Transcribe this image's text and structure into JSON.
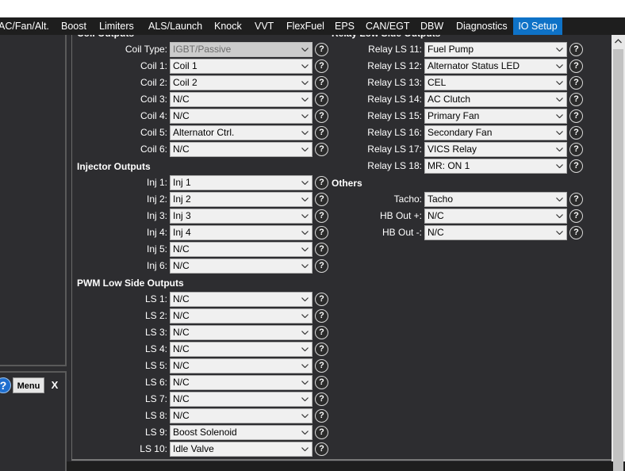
{
  "menu": {
    "items": [
      "AC/Fan/Alt.",
      "Boost",
      "Limiters",
      "ALS/Launch",
      "Knock",
      "VVT",
      "FlexFuel",
      "EPS",
      "CAN/EGT",
      "DBW",
      "Diagnostics",
      "IO Setup"
    ],
    "active": "IO Setup"
  },
  "left_panel": {
    "help_glyph": "?",
    "menu_label": "Menu",
    "close_label": "X"
  },
  "coil": {
    "title": "Coil Outputs",
    "type_label": "Coil Type:",
    "type_value": "IGBT/Passive",
    "rows": [
      {
        "label": "Coil 1:",
        "value": "Coil 1"
      },
      {
        "label": "Coil 2:",
        "value": "Coil 2"
      },
      {
        "label": "Coil 3:",
        "value": "N/C"
      },
      {
        "label": "Coil 4:",
        "value": "N/C"
      },
      {
        "label": "Coil 5:",
        "value": "Alternator Ctrl."
      },
      {
        "label": "Coil 6:",
        "value": "N/C"
      }
    ]
  },
  "injector": {
    "title": "Injector Outputs",
    "rows": [
      {
        "label": "Inj 1:",
        "value": "Inj 1"
      },
      {
        "label": "Inj 2:",
        "value": "Inj 2"
      },
      {
        "label": "Inj 3:",
        "value": "Inj 3"
      },
      {
        "label": "Inj 4:",
        "value": "Inj 4"
      },
      {
        "label": "Inj 5:",
        "value": "N/C"
      },
      {
        "label": "Inj 6:",
        "value": "N/C"
      }
    ]
  },
  "pwm": {
    "title": "PWM Low Side Outputs",
    "rows": [
      {
        "label": "LS 1:",
        "value": "N/C"
      },
      {
        "label": "LS 2:",
        "value": "N/C"
      },
      {
        "label": "LS 3:",
        "value": "N/C"
      },
      {
        "label": "LS 4:",
        "value": "N/C"
      },
      {
        "label": "LS 5:",
        "value": "N/C"
      },
      {
        "label": "LS 6:",
        "value": "N/C"
      },
      {
        "label": "LS 7:",
        "value": "N/C"
      },
      {
        "label": "LS 8:",
        "value": "N/C"
      },
      {
        "label": "LS 9:",
        "value": "Boost Solenoid"
      },
      {
        "label": "LS 10:",
        "value": "Idle Valve"
      }
    ]
  },
  "relay": {
    "title": "Relay Low Side Outputs",
    "rows": [
      {
        "label": "Relay LS 11:",
        "value": "Fuel Pump"
      },
      {
        "label": "Relay LS 12:",
        "value": "Alternator Status LED"
      },
      {
        "label": "Relay LS 13:",
        "value": "CEL"
      },
      {
        "label": "Relay LS 14:",
        "value": "AC Clutch"
      },
      {
        "label": "Relay LS 15:",
        "value": "Primary Fan"
      },
      {
        "label": "Relay LS 16:",
        "value": "Secondary Fan"
      },
      {
        "label": "Relay LS 17:",
        "value": "VICS Relay"
      },
      {
        "label": "Relay LS 18:",
        "value": "MR: ON 1"
      }
    ]
  },
  "others": {
    "title": "Others",
    "rows": [
      {
        "label": "Tacho:",
        "value": "Tacho"
      },
      {
        "label": "HB Out +:",
        "value": "N/C"
      },
      {
        "label": "HB Out -:",
        "value": "N/C"
      }
    ]
  },
  "help_glyph": "?",
  "colors": {
    "background": "#2d2d30",
    "menubar": "#1e1e1e",
    "active_tab": "#0e72c7",
    "dropdown": "#f0f0f0"
  }
}
